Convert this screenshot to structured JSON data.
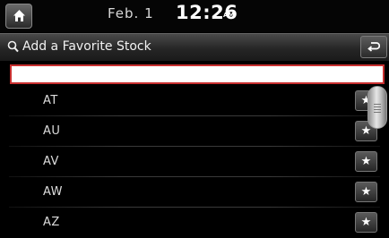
{
  "status": {
    "date": "Feb.  1",
    "time": "12:26",
    "ampm": "AM"
  },
  "header": {
    "title": "Add a Favorite Stock",
    "search_icon": "search-icon",
    "back_icon": "back-icon"
  },
  "search": {
    "value": ""
  },
  "list": {
    "items": [
      {
        "label": "AT"
      },
      {
        "label": "AU"
      },
      {
        "label": "AV"
      },
      {
        "label": "AW"
      },
      {
        "label": "AZ"
      }
    ],
    "favorite_symbol": "★"
  }
}
